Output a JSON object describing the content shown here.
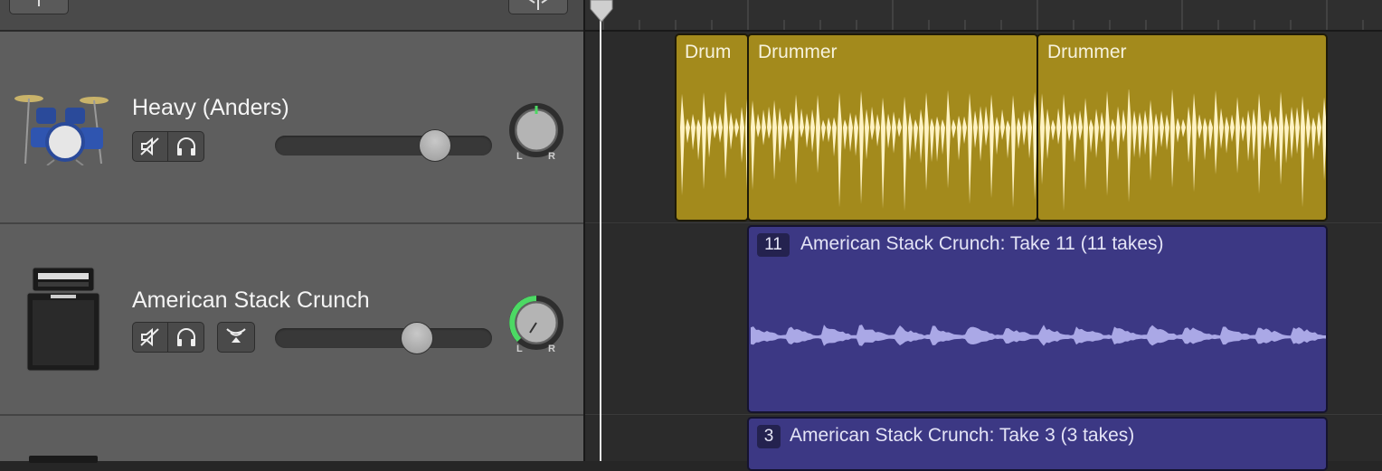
{
  "tracks": [
    {
      "name": "Heavy (Anders)",
      "volume_fraction": 0.78,
      "pan_fraction": 0.5,
      "pan_labels": {
        "left": "L",
        "right": "R"
      },
      "icon": "drum-kit-icon",
      "regions": [
        {
          "title": "Drum"
        },
        {
          "title": "Drummer"
        },
        {
          "title": "Drummer"
        }
      ]
    },
    {
      "name": "American Stack Crunch",
      "volume_fraction": 0.68,
      "pan_fraction": 0.35,
      "pan_labels": {
        "left": "L",
        "right": "R"
      },
      "icon": "amp-stack-icon",
      "regions": [
        {
          "take_number": "11",
          "title": "American Stack Crunch: Take 11 (11 takes)"
        }
      ]
    },
    {
      "name": "",
      "icon": "amp-stack-icon",
      "regions": [
        {
          "take_number": "3",
          "title": "American Stack Crunch: Take 3 (3 takes)"
        }
      ]
    }
  ],
  "colors": {
    "drummer_region": "#a38a1c",
    "audio_region": "#3c3884",
    "drum_waveform": "#fff3c4",
    "audio_waveform": "#aaa8e6",
    "pan_active": "#4cd964"
  }
}
